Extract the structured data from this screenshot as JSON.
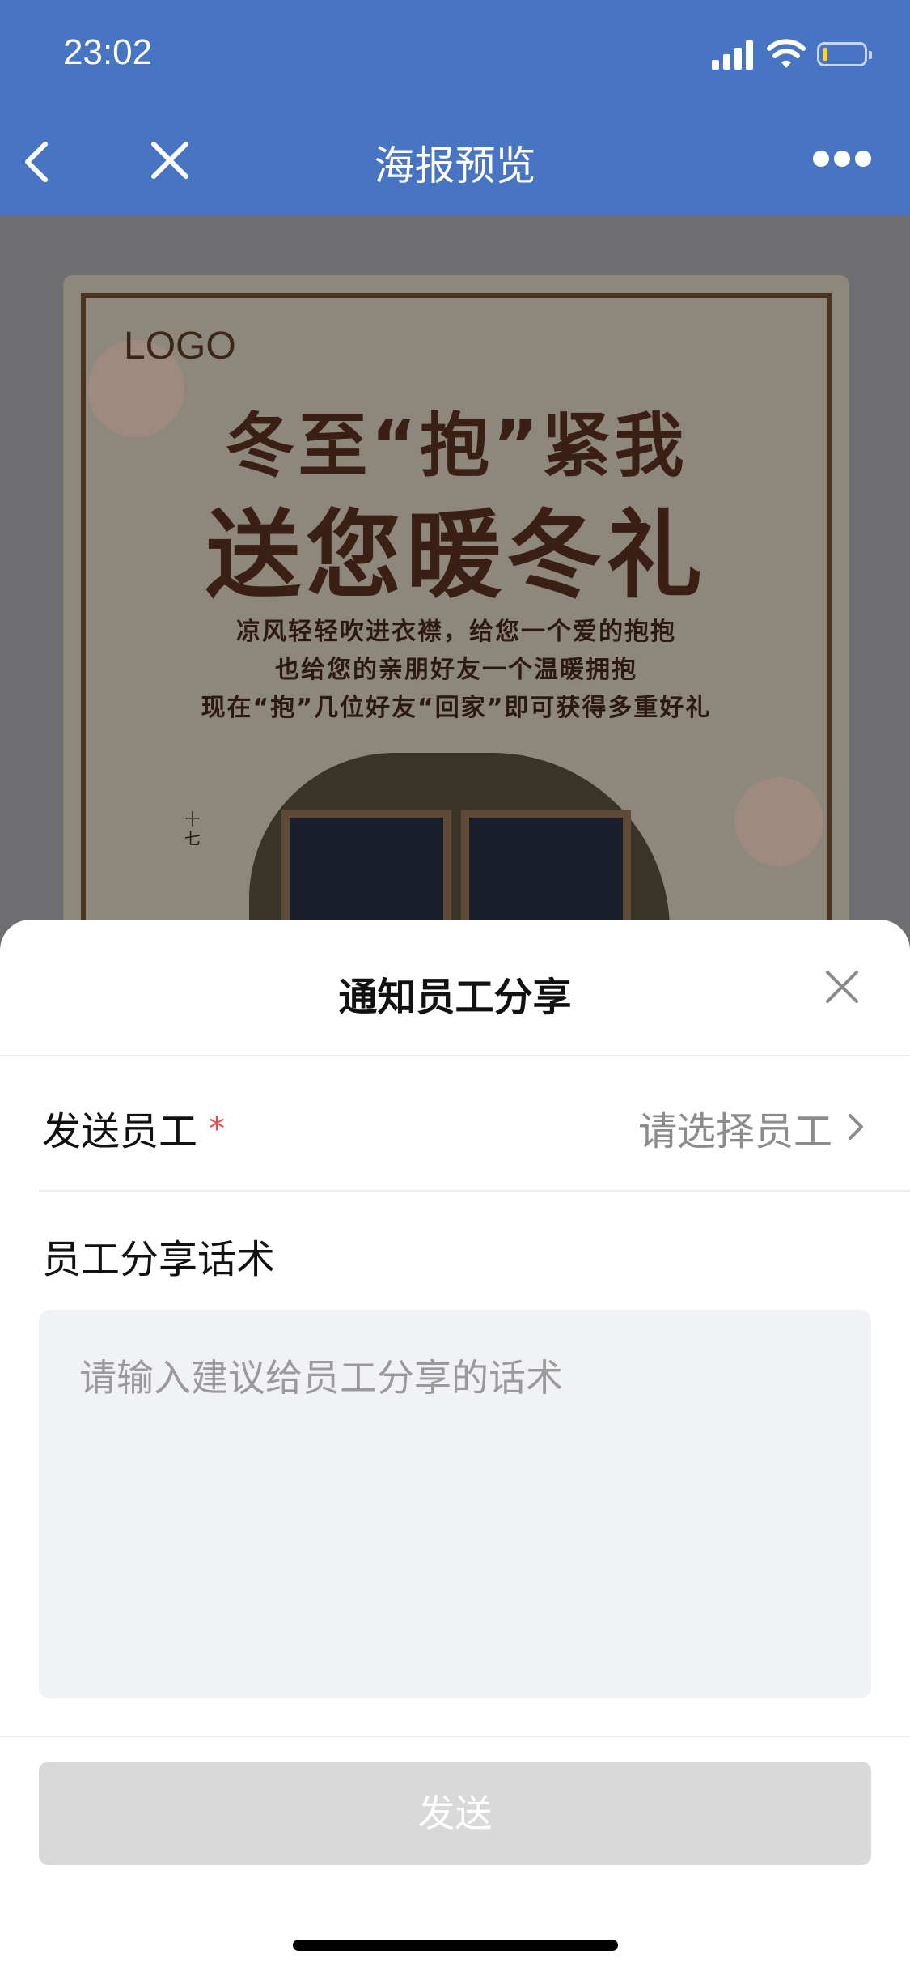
{
  "status_bar": {
    "time": "23:02"
  },
  "nav": {
    "title": "海报预览"
  },
  "poster": {
    "logo_text": "LOGO",
    "headline": "冬至“抱”紧我",
    "subheadline": "送您暖冬礼",
    "body_lines": [
      "凉风轻轻吹进衣襟，给您一个爱的抱抱",
      "也给您的亲朋好友一个温暖拥抱",
      "现在“抱”几位好友“回家”即可获得多重好礼"
    ],
    "stamp_text": "十七"
  },
  "sheet": {
    "title": "通知员工分享",
    "send_employee_label": "发送员工",
    "required_mark": "*",
    "select_placeholder": "请选择员工",
    "script_label": "员工分享话术",
    "script_placeholder": "请输入建议给员工分享的话术",
    "send_button_label": "发送"
  },
  "colors": {
    "header_bg": "#4874C4",
    "required": "#e34d4d",
    "disabled_button": "#d9d9d9",
    "textarea_bg": "#f1f2f6"
  }
}
